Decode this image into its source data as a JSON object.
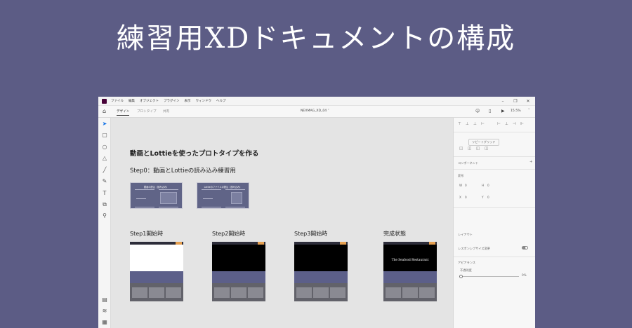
{
  "banner": {
    "title": "練習用XDドキュメントの構成"
  },
  "app": {
    "menu": [
      "ファイル",
      "編集",
      "オブジェクト",
      "プラグイン",
      "表示",
      "ウィンドウ",
      "ヘルプ"
    ],
    "window_controls": {
      "minimize": "–",
      "maximize": "❐",
      "close": "✕"
    },
    "tabs": [
      "デザイン",
      "プロトタイプ",
      "共有"
    ],
    "active_tab": "デザイン",
    "document_title": "NEXMAG_XD_04 ˅",
    "zoom": "15.5%"
  },
  "canvas": {
    "heading": "動画とLottieを使ったプロトタイプを作る",
    "step0_heading": "Step0：動画とLottieの読み込み練習用",
    "step0_boards": [
      {
        "title": "動画の読込（読み込み）"
      },
      {
        "title": "Lottieのファイルの読込（読み込み）"
      }
    ],
    "boards": [
      {
        "label": "Step1開始時",
        "hero_color": "#ffffff",
        "hero_text": ""
      },
      {
        "label": "Step2開始時",
        "hero_color": "#000000",
        "hero_text": ""
      },
      {
        "label": "Step3開始時",
        "hero_color": "#000000",
        "hero_text": ""
      },
      {
        "label": "完成状態",
        "hero_color": "#000000",
        "hero_text": "The Seafood Restaurant"
      }
    ]
  },
  "panel": {
    "repeat_grid": "リピートグリッド",
    "component": "コンポーネント",
    "transform": "変形",
    "w_label": "W",
    "w_value": "0",
    "h_label": "H",
    "h_value": "0",
    "x_label": "X",
    "x_value": "0",
    "y_label": "Y",
    "y_value": "0",
    "layout": "レイアウト",
    "responsive": "レスポンシブサイズ変更",
    "appearance": "アピアランス",
    "opacity_label": "不透明度",
    "opacity_value": "0%"
  }
}
